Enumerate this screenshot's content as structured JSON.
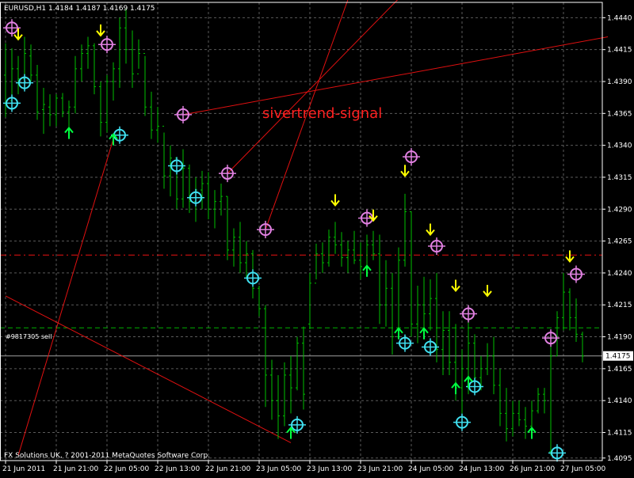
{
  "chart_data": {
    "type": "bar",
    "subtype": "ohlc",
    "symbol_header": "EURUSD,H1  1.4184 1.4187 1.4169 1.4175",
    "annotation": "sivertrend-signal",
    "copyright": "FX Solutions UK, ? 2001-2011 MetaQuotes Software Corp.",
    "order_line_label": "#9817305 sell",
    "order_price": 1.4197,
    "resistance_level": 1.4254,
    "current_price": 1.4175,
    "current_price_label": "1.4175",
    "ylim": [
      1.4093,
      1.4452
    ],
    "yticks": [
      "1.4440",
      "1.4415",
      "1.4390",
      "1.4365",
      "1.4340",
      "1.4315",
      "1.4290",
      "1.4265",
      "1.4240",
      "1.4215",
      "1.4190",
      "1.4165",
      "1.4140",
      "1.4115",
      "1.4095"
    ],
    "xticks": [
      {
        "label": "21 Jun 2011",
        "bar": 0
      },
      {
        "label": "21 Jun 21:00",
        "bar": 8
      },
      {
        "label": "22 Jun 05:00",
        "bar": 16
      },
      {
        "label": "22 Jun 13:00",
        "bar": 24
      },
      {
        "label": "22 Jun 21:00",
        "bar": 32
      },
      {
        "label": "23 Jun 05:00",
        "bar": 40
      },
      {
        "label": "23 Jun 13:00",
        "bar": 48
      },
      {
        "label": "23 Jun 21:00",
        "bar": 56
      },
      {
        "label": "24 Jun 05:00",
        "bar": 64
      },
      {
        "label": "24 Jun 13:00",
        "bar": 72
      },
      {
        "label": "26 Jun 21:00",
        "bar": 80
      },
      {
        "label": "27 Jun 05:00",
        "bar": 88
      }
    ],
    "colors": {
      "background": "#000000",
      "grid": "#5a5a5a",
      "bars": "#00c000",
      "trendlines": "#e01010",
      "arrow_down": "#ffff00",
      "arrow_up": "#00ff40",
      "circle_magenta": "#e080e0",
      "circle_cyan": "#40e0f0",
      "order_line": "#00b000",
      "price_line": "#a0a0a0"
    },
    "bars": [
      {
        "h": 1.442,
        "l": 1.4362,
        "o": 1.4395,
        "c": 1.4372
      },
      {
        "h": 1.4416,
        "l": 1.437,
        "o": 1.4375,
        "c": 1.44
      },
      {
        "h": 1.441,
        "l": 1.438,
        "o": 1.44,
        "c": 1.4392
      },
      {
        "h": 1.4425,
        "l": 1.4383,
        "o": 1.4392,
        "c": 1.4412
      },
      {
        "h": 1.4419,
        "l": 1.439,
        "o": 1.441,
        "c": 1.4395
      },
      {
        "h": 1.4403,
        "l": 1.436,
        "o": 1.4395,
        "c": 1.4366
      },
      {
        "h": 1.4385,
        "l": 1.4349,
        "o": 1.4368,
        "c": 1.4372
      },
      {
        "h": 1.438,
        "l": 1.4355,
        "o": 1.437,
        "c": 1.4364
      },
      {
        "h": 1.438,
        "l": 1.4355,
        "o": 1.4364,
        "c": 1.4377
      },
      {
        "h": 1.4381,
        "l": 1.4362,
        "o": 1.4377,
        "c": 1.4366
      },
      {
        "h": 1.4375,
        "l": 1.4354,
        "o": 1.4366,
        "c": 1.437
      },
      {
        "h": 1.441,
        "l": 1.4365,
        "o": 1.437,
        "c": 1.44
      },
      {
        "h": 1.4419,
        "l": 1.439,
        "o": 1.44,
        "c": 1.4412
      },
      {
        "h": 1.4425,
        "l": 1.44,
        "o": 1.4412,
        "c": 1.4418
      },
      {
        "h": 1.442,
        "l": 1.438,
        "o": 1.4418,
        "c": 1.4386
      },
      {
        "h": 1.439,
        "l": 1.4347,
        "o": 1.4386,
        "c": 1.4358
      },
      {
        "h": 1.4395,
        "l": 1.435,
        "o": 1.4358,
        "c": 1.439
      },
      {
        "h": 1.4405,
        "l": 1.4375,
        "o": 1.439,
        "c": 1.44
      },
      {
        "h": 1.444,
        "l": 1.4385,
        "o": 1.44,
        "c": 1.4432
      },
      {
        "h": 1.4447,
        "l": 1.4404,
        "o": 1.4432,
        "c": 1.4415
      },
      {
        "h": 1.443,
        "l": 1.4385,
        "o": 1.4415,
        "c": 1.4396
      },
      {
        "h": 1.4423,
        "l": 1.44,
        "o": 1.4396,
        "c": 1.4412
      },
      {
        "h": 1.441,
        "l": 1.4363,
        "o": 1.4412,
        "c": 1.437
      },
      {
        "h": 1.4382,
        "l": 1.4345,
        "o": 1.437,
        "c": 1.4352
      },
      {
        "h": 1.437,
        "l": 1.4342,
        "o": 1.4352,
        "c": 1.4355
      },
      {
        "h": 1.435,
        "l": 1.4306,
        "o": 1.4355,
        "c": 1.4316
      },
      {
        "h": 1.434,
        "l": 1.43,
        "o": 1.4316,
        "c": 1.433
      },
      {
        "h": 1.4325,
        "l": 1.429,
        "o": 1.433,
        "c": 1.4298
      },
      {
        "h": 1.4337,
        "l": 1.4291,
        "o": 1.4298,
        "c": 1.4322
      },
      {
        "h": 1.4325,
        "l": 1.4287,
        "o": 1.4322,
        "c": 1.4296
      },
      {
        "h": 1.4315,
        "l": 1.428,
        "o": 1.4296,
        "c": 1.4305
      },
      {
        "h": 1.432,
        "l": 1.429,
        "o": 1.4305,
        "c": 1.431
      },
      {
        "h": 1.4319,
        "l": 1.4282,
        "o": 1.431,
        "c": 1.429
      },
      {
        "h": 1.4305,
        "l": 1.4275,
        "o": 1.429,
        "c": 1.4296
      },
      {
        "h": 1.431,
        "l": 1.4285,
        "o": 1.4296,
        "c": 1.43
      },
      {
        "h": 1.43,
        "l": 1.425,
        "o": 1.43,
        "c": 1.4258
      },
      {
        "h": 1.4275,
        "l": 1.4245,
        "o": 1.4258,
        "c": 1.4268
      },
      {
        "h": 1.428,
        "l": 1.424,
        "o": 1.4268,
        "c": 1.4248
      },
      {
        "h": 1.4265,
        "l": 1.4236,
        "o": 1.4248,
        "c": 1.4255
      },
      {
        "h": 1.4258,
        "l": 1.422,
        "o": 1.4255,
        "c": 1.4228
      },
      {
        "h": 1.423,
        "l": 1.4206,
        "o": 1.4228,
        "c": 1.4212
      },
      {
        "h": 1.4215,
        "l": 1.4135,
        "o": 1.4212,
        "c": 1.416
      },
      {
        "h": 1.4172,
        "l": 1.4125,
        "o": 1.416,
        "c": 1.414
      },
      {
        "h": 1.416,
        "l": 1.411,
        "o": 1.414,
        "c": 1.4128
      },
      {
        "h": 1.417,
        "l": 1.412,
        "o": 1.4128,
        "c": 1.416
      },
      {
        "h": 1.4175,
        "l": 1.413,
        "o": 1.416,
        "c": 1.415
      },
      {
        "h": 1.419,
        "l": 1.4148,
        "o": 1.415,
        "c": 1.4185
      },
      {
        "h": 1.4198,
        "l": 1.4133,
        "o": 1.4185,
        "c": 1.4145
      },
      {
        "h": 1.424,
        "l": 1.4196,
        "o": 1.42,
        "c": 1.4232
      },
      {
        "h": 1.4263,
        "l": 1.4235,
        "o": 1.4232,
        "c": 1.4255
      },
      {
        "h": 1.4264,
        "l": 1.424,
        "o": 1.4255,
        "c": 1.4248
      },
      {
        "h": 1.4274,
        "l": 1.4245,
        "o": 1.4248,
        "c": 1.4268
      },
      {
        "h": 1.428,
        "l": 1.4255,
        "o": 1.4268,
        "c": 1.4262
      },
      {
        "h": 1.4272,
        "l": 1.4245,
        "o": 1.4262,
        "c": 1.4252
      },
      {
        "h": 1.4265,
        "l": 1.424,
        "o": 1.4252,
        "c": 1.4258
      },
      {
        "h": 1.4273,
        "l": 1.4247,
        "o": 1.4258,
        "c": 1.425
      },
      {
        "h": 1.4264,
        "l": 1.4235,
        "o": 1.425,
        "c": 1.4245
      },
      {
        "h": 1.427,
        "l": 1.424,
        "o": 1.4245,
        "c": 1.4262
      },
      {
        "h": 1.4273,
        "l": 1.425,
        "o": 1.4262,
        "c": 1.4255
      },
      {
        "h": 1.427,
        "l": 1.42,
        "o": 1.4255,
        "c": 1.4215
      },
      {
        "h": 1.425,
        "l": 1.4198,
        "o": 1.4215,
        "c": 1.4228
      },
      {
        "h": 1.424,
        "l": 1.4176,
        "o": 1.4228,
        "c": 1.419
      },
      {
        "h": 1.426,
        "l": 1.419,
        "o": 1.419,
        "c": 1.425
      },
      {
        "h": 1.4302,
        "l": 1.4245,
        "o": 1.425,
        "c": 1.4288
      },
      {
        "h": 1.4288,
        "l": 1.419,
        "o": 1.4288,
        "c": 1.42
      },
      {
        "h": 1.423,
        "l": 1.4185,
        "o": 1.42,
        "c": 1.4215
      },
      {
        "h": 1.4237,
        "l": 1.4195,
        "o": 1.4215,
        "c": 1.4208
      },
      {
        "h": 1.4235,
        "l": 1.4195,
        "o": 1.4208,
        "c": 1.422
      },
      {
        "h": 1.424,
        "l": 1.417,
        "o": 1.422,
        "c": 1.418
      },
      {
        "h": 1.421,
        "l": 1.416,
        "o": 1.418,
        "c": 1.4195
      },
      {
        "h": 1.421,
        "l": 1.416,
        "o": 1.4195,
        "c": 1.417
      },
      {
        "h": 1.42,
        "l": 1.414,
        "o": 1.417,
        "c": 1.415
      },
      {
        "h": 1.418,
        "l": 1.413,
        "o": 1.415,
        "c": 1.4165
      },
      {
        "h": 1.4202,
        "l": 1.4145,
        "o": 1.4165,
        "c": 1.4185
      },
      {
        "h": 1.4192,
        "l": 1.4148,
        "o": 1.4185,
        "c": 1.4158
      },
      {
        "h": 1.4175,
        "l": 1.4148,
        "o": 1.4158,
        "c": 1.4165
      },
      {
        "h": 1.4185,
        "l": 1.416,
        "o": 1.4165,
        "c": 1.4175
      },
      {
        "h": 1.419,
        "l": 1.4145,
        "o": 1.4175,
        "c": 1.4152
      },
      {
        "h": 1.4165,
        "l": 1.412,
        "o": 1.4152,
        "c": 1.413
      },
      {
        "h": 1.415,
        "l": 1.4108,
        "o": 1.413,
        "c": 1.4118
      },
      {
        "h": 1.414,
        "l": 1.4112,
        "o": 1.4118,
        "c": 1.413
      },
      {
        "h": 1.414,
        "l": 1.412,
        "o": 1.413,
        "c": 1.4125
      },
      {
        "h": 1.4135,
        "l": 1.411,
        "o": 1.4125,
        "c": 1.412
      },
      {
        "h": 1.414,
        "l": 1.4115,
        "o": 1.412,
        "c": 1.4132
      },
      {
        "h": 1.415,
        "l": 1.413,
        "o": 1.4132,
        "c": 1.4145
      },
      {
        "h": 1.415,
        "l": 1.413,
        "o": 1.4145,
        "c": 1.414
      },
      {
        "h": 1.4185,
        "l": 1.4097,
        "o": 1.41,
        "c": 1.4175
      },
      {
        "h": 1.421,
        "l": 1.4175,
        "o": 1.4175,
        "c": 1.4205
      },
      {
        "h": 1.424,
        "l": 1.4195,
        "o": 1.4205,
        "c": 1.4225
      },
      {
        "h": 1.4228,
        "l": 1.4195,
        "o": 1.4225,
        "c": 1.4205
      },
      {
        "h": 1.422,
        "l": 1.4186,
        "o": 1.4205,
        "c": 1.4192
      },
      {
        "h": 1.4194,
        "l": 1.417,
        "o": 1.4192,
        "c": 1.4175
      }
    ],
    "down_arrows": [
      {
        "bar": 2,
        "price": 1.4423
      },
      {
        "bar": 15,
        "price": 1.4426
      },
      {
        "bar": 21,
        "price": 1.4459
      },
      {
        "bar": 52,
        "price": 1.4293
      },
      {
        "bar": 58,
        "price": 1.4281
      },
      {
        "bar": 63,
        "price": 1.4316
      },
      {
        "bar": 67,
        "price": 1.427
      },
      {
        "bar": 71,
        "price": 1.4226
      },
      {
        "bar": 76,
        "price": 1.4222
      },
      {
        "bar": 89,
        "price": 1.4249
      }
    ],
    "up_arrows": [
      {
        "bar": 10,
        "price": 1.4345
      },
      {
        "bar": 17,
        "price": 1.434
      },
      {
        "bar": 45,
        "price": 1.411
      },
      {
        "bar": 57,
        "price": 1.4237
      },
      {
        "bar": 62,
        "price": 1.4188
      },
      {
        "bar": 66,
        "price": 1.4188
      },
      {
        "bar": 71,
        "price": 1.4145
      },
      {
        "bar": 73,
        "price": 1.415
      },
      {
        "bar": 83,
        "price": 1.411
      }
    ],
    "circles": [
      {
        "bar": 1,
        "price": 1.4432,
        "color": "magenta"
      },
      {
        "bar": 16,
        "price": 1.4419,
        "color": "magenta"
      },
      {
        "bar": 28,
        "price": 1.4364,
        "color": "magenta"
      },
      {
        "bar": 35,
        "price": 1.4318,
        "color": "magenta"
      },
      {
        "bar": 41,
        "price": 1.4274,
        "color": "magenta"
      },
      {
        "bar": 57,
        "price": 1.4283,
        "color": "magenta"
      },
      {
        "bar": 64,
        "price": 1.4331,
        "color": "magenta"
      },
      {
        "bar": 68,
        "price": 1.4261,
        "color": "magenta"
      },
      {
        "bar": 73,
        "price": 1.4208,
        "color": "magenta"
      },
      {
        "bar": 86,
        "price": 1.4189,
        "color": "magenta"
      },
      {
        "bar": 90,
        "price": 1.4239,
        "color": "magenta"
      },
      {
        "bar": 1,
        "price": 1.4373,
        "color": "cyan"
      },
      {
        "bar": 3,
        "price": 1.4389,
        "color": "cyan"
      },
      {
        "bar": 18,
        "price": 1.4348,
        "color": "cyan"
      },
      {
        "bar": 27,
        "price": 1.4324,
        "color": "cyan"
      },
      {
        "bar": 30,
        "price": 1.4299,
        "color": "cyan"
      },
      {
        "bar": 39,
        "price": 1.4236,
        "color": "cyan"
      },
      {
        "bar": 46,
        "price": 1.4121,
        "color": "cyan"
      },
      {
        "bar": 63,
        "price": 1.4185,
        "color": "cyan"
      },
      {
        "bar": 67,
        "price": 1.4182,
        "color": "cyan"
      },
      {
        "bar": 72,
        "price": 1.4123,
        "color": "cyan"
      },
      {
        "bar": 74,
        "price": 1.4151,
        "color": "cyan"
      },
      {
        "bar": 87,
        "price": 1.4099,
        "color": "cyan"
      }
    ],
    "trendlines": [
      {
        "from": {
          "bar": 28,
          "price": 1.4364
        },
        "to": {
          "bar": 95,
          "price": 1.4425
        }
      },
      {
        "from": {
          "bar": 35,
          "price": 1.4318
        },
        "to": {
          "bar": 64,
          "price": 1.4465
        }
      },
      {
        "from": {
          "bar": 41,
          "price": 1.4274
        },
        "to": {
          "bar": 55,
          "price": 1.4468
        }
      },
      {
        "from": {
          "bar": 2,
          "price": 1.4097
        },
        "to": {
          "bar": 17,
          "price": 1.4345
        }
      },
      {
        "from": {
          "bar": 0,
          "price": 1.4222
        },
        "to": {
          "bar": 45,
          "price": 1.4107
        }
      }
    ]
  }
}
